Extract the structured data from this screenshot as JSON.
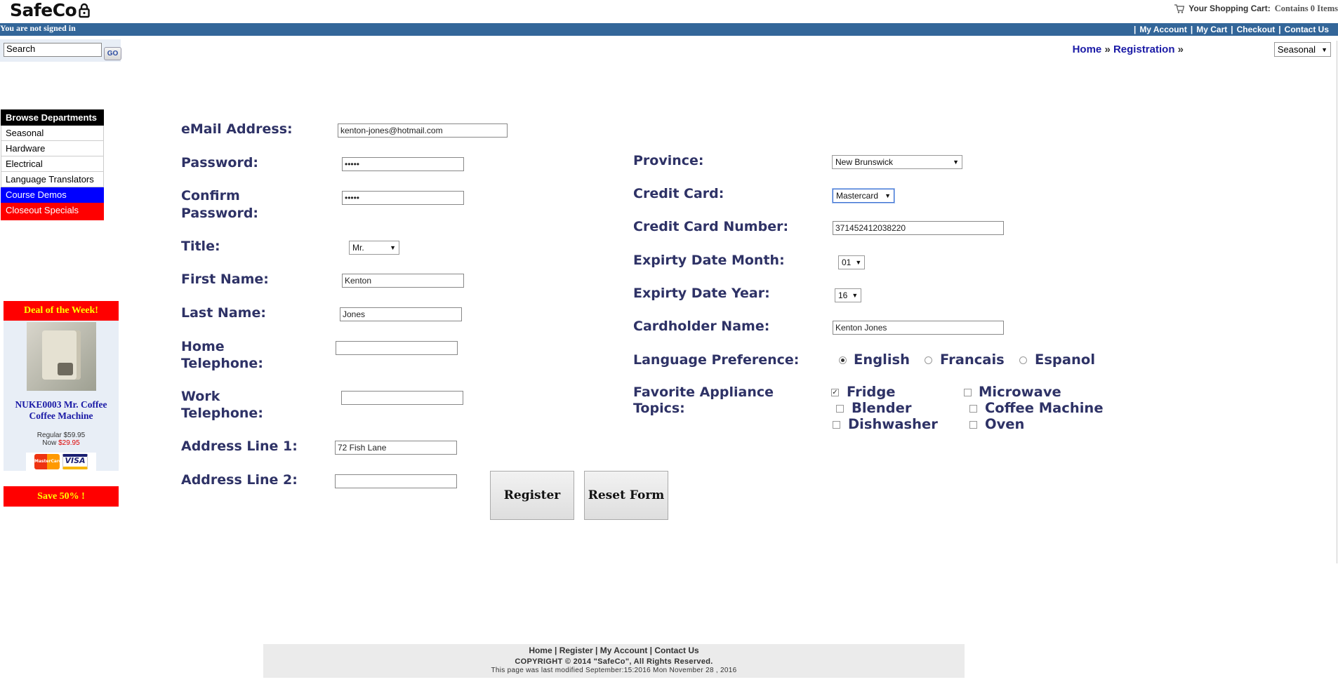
{
  "header": {
    "logo": "SafeCo",
    "cart_label": "Your Shopping Cart:",
    "cart_count": "Contains 0 Items",
    "signin_status": "You are not signed in",
    "nav": [
      "My Account",
      "My Cart",
      "Checkout",
      "Contact Us"
    ],
    "search_value": "Search",
    "go_label": "GO",
    "breadcrumb": [
      "Home",
      "Registration"
    ],
    "breadcrumb_sep": "»",
    "category_select": "Seasonal"
  },
  "sidebar": {
    "departments_title": "Browse Departments",
    "departments": [
      "Seasonal",
      "Hardware",
      "Electrical",
      "Language Translators",
      "Course Demos",
      "Closeout Specials"
    ],
    "deal_title": "Deal of the Week!",
    "deal_product": "NUKE0003 Mr. Coffee Coffee Machine",
    "deal_regular": "Regular $59.95",
    "deal_now_label": "Now",
    "deal_now_price": "$29.95",
    "card_mastercard": "MasterCard",
    "card_visa": "VISA",
    "save_text": "Save 50% !"
  },
  "form": {
    "email_label": "eMail Address:",
    "email_value": "kenton-jones@hotmail.com",
    "password_label": "Password:",
    "password_value": "•••••",
    "confirm_label_1": "Confirm",
    "confirm_label_2": "Password:",
    "confirm_value": "•••••",
    "title_label": "Title:",
    "title_value": "Mr.",
    "first_name_label": "First Name:",
    "first_name_value": "Kenton",
    "last_name_label": "Last Name:",
    "last_name_value": "Jones",
    "home_tel_label_1": "Home",
    "home_tel_label_2": "Telephone:",
    "home_tel_value": "",
    "work_tel_label_1": "Work",
    "work_tel_label_2": "Telephone:",
    "work_tel_value": "",
    "addr1_label": "Address Line 1:",
    "addr1_value": "72 Fish Lane",
    "addr2_label": "Address Line 2:",
    "addr2_value": "",
    "province_label": "Province:",
    "province_value": "New Brunswick",
    "cc_label": "Credit Card:",
    "cc_value": "Mastercard",
    "ccnum_label": "Credit Card Number:",
    "ccnum_value": "371452412038220",
    "exp_month_label": "Expirty Date Month:",
    "exp_month_value": "01",
    "exp_year_label": "Expirty Date Year:",
    "exp_year_value": "16",
    "cardholder_label": "Cardholder Name:",
    "cardholder_value": "Kenton Jones",
    "lang_label": "Language Preference:",
    "languages": [
      "English",
      "Francais",
      "Espanol"
    ],
    "lang_selected": "English",
    "topics_label_1": "Favorite Appliance",
    "topics_label_2": "Topics:",
    "topics": {
      "fridge": {
        "label": "Fridge",
        "checked": true
      },
      "microwave": {
        "label": "Microwave",
        "checked": false
      },
      "blender": {
        "label": "Blender",
        "checked": false
      },
      "coffee": {
        "label": "Coffee Machine",
        "checked": false
      },
      "dishwasher": {
        "label": "Dishwasher",
        "checked": false
      },
      "oven": {
        "label": "Oven",
        "checked": false
      }
    },
    "register_label": "Register",
    "reset_label": "Reset Form"
  },
  "footer": {
    "links": [
      "Home",
      "Register",
      "My Account",
      "Contact Us"
    ],
    "copyright": "COPYRIGHT © 2014 \"SafeCo\", All Rights Reserved.",
    "modified": "This page was last modified September:15:2016 Mon November 28 , 2016"
  },
  "colors": {
    "topbar": "#336699",
    "label": "#2e3266",
    "link": "#1a1aa6",
    "deal_red": "#ff0000",
    "deal_yellow": "#ffff00",
    "course_blue": "#0000ff"
  }
}
